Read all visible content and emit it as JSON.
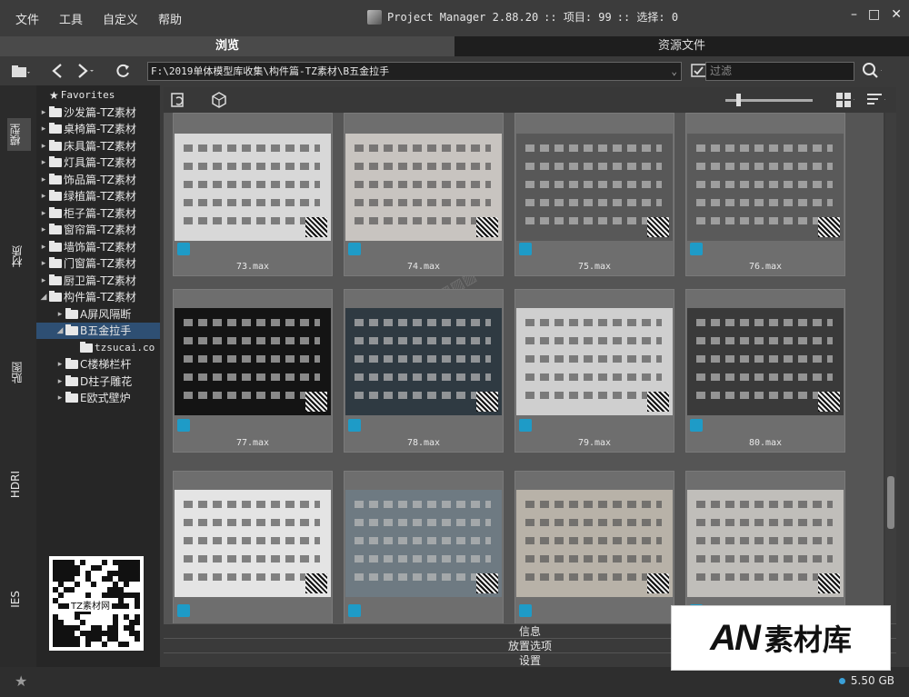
{
  "menu": [
    "文件",
    "工具",
    "自定义",
    "帮助"
  ],
  "title": {
    "app": "Project Manager 2.88.20",
    "items_label": ":: 项目: 99",
    "selected_label": ":: 选择: 0"
  },
  "window_buttons": [
    "–",
    "□",
    "✕"
  ],
  "tabs": [
    {
      "label": "浏览",
      "active": true
    },
    {
      "label": "资源文件",
      "active": false
    }
  ],
  "toolbar": {
    "path": "F:\\2019单体模型库收集\\构件篇-TZ素材\\B五金拉手",
    "filter_placeholder": "过滤"
  },
  "vertical_tabs": [
    "模型",
    "材质",
    "贴图",
    "HDRI",
    "IES"
  ],
  "tree": [
    {
      "label": "Favorites",
      "level": 0,
      "type": "favorites",
      "expanded": false
    },
    {
      "label": "沙发篇-TZ素材",
      "level": 0,
      "type": "folder",
      "expanded": false
    },
    {
      "label": "桌椅篇-TZ素材",
      "level": 0,
      "type": "folder",
      "expanded": false
    },
    {
      "label": "床具篇-TZ素材",
      "level": 0,
      "type": "folder",
      "expanded": false
    },
    {
      "label": "灯具篇-TZ素材",
      "level": 0,
      "type": "folder",
      "expanded": false
    },
    {
      "label": "饰品篇-TZ素材",
      "level": 0,
      "type": "folder",
      "expanded": false
    },
    {
      "label": "绿植篇-TZ素材",
      "level": 0,
      "type": "folder",
      "expanded": false
    },
    {
      "label": "柜子篇-TZ素材",
      "level": 0,
      "type": "folder",
      "expanded": false
    },
    {
      "label": "窗帘篇-TZ素材",
      "level": 0,
      "type": "folder",
      "expanded": false
    },
    {
      "label": "墙饰篇-TZ素材",
      "level": 0,
      "type": "folder",
      "expanded": false
    },
    {
      "label": "门窗篇-TZ素材",
      "level": 0,
      "type": "folder",
      "expanded": false
    },
    {
      "label": "厨卫篇-TZ素材",
      "level": 0,
      "type": "folder",
      "expanded": false
    },
    {
      "label": "构件篇-TZ素材",
      "level": 0,
      "type": "folder",
      "expanded": true
    },
    {
      "label": "A屏风隔断",
      "level": 1,
      "type": "folder",
      "expanded": false
    },
    {
      "label": "B五金拉手",
      "level": 1,
      "type": "folder",
      "expanded": true,
      "selected": true
    },
    {
      "label": "tzsucai.co",
      "level": 2,
      "type": "folder",
      "expanded": false
    },
    {
      "label": "C楼梯栏杆",
      "level": 1,
      "type": "folder",
      "expanded": false
    },
    {
      "label": "D柱子雕花",
      "level": 1,
      "type": "folder",
      "expanded": false
    },
    {
      "label": "E欧式壁炉",
      "level": 1,
      "type": "folder",
      "expanded": false
    }
  ],
  "sidebar_qr_label": "TZ素材网",
  "files": [
    {
      "name": "73.max",
      "bg": "#d8d8d8"
    },
    {
      "name": "74.max",
      "bg": "#c8c4c0"
    },
    {
      "name": "75.max",
      "bg": "#585858"
    },
    {
      "name": "76.max",
      "bg": "#5a5a5a"
    },
    {
      "name": "77.max",
      "bg": "#141414"
    },
    {
      "name": "78.max",
      "bg": "#2f3a42"
    },
    {
      "name": "79.max",
      "bg": "#cfcfcf"
    },
    {
      "name": "80.max",
      "bg": "#3a3a3a"
    },
    {
      "name": "",
      "bg": "#e4e4e4"
    },
    {
      "name": "",
      "bg": "#6e7a82"
    },
    {
      "name": "",
      "bg": "#b8b2a8"
    },
    {
      "name": "",
      "bg": "#c0beba"
    }
  ],
  "bottom_panels": [
    "信息",
    "放置选项",
    "设置"
  ],
  "status": {
    "disk_free": "5.50 GB"
  },
  "logo": {
    "brand": "AN",
    "text": "素材库"
  },
  "colors": {
    "accent": "#2e4f73",
    "status_dot": "#3aa0d8",
    "max_icon": "#1e9bc7"
  }
}
